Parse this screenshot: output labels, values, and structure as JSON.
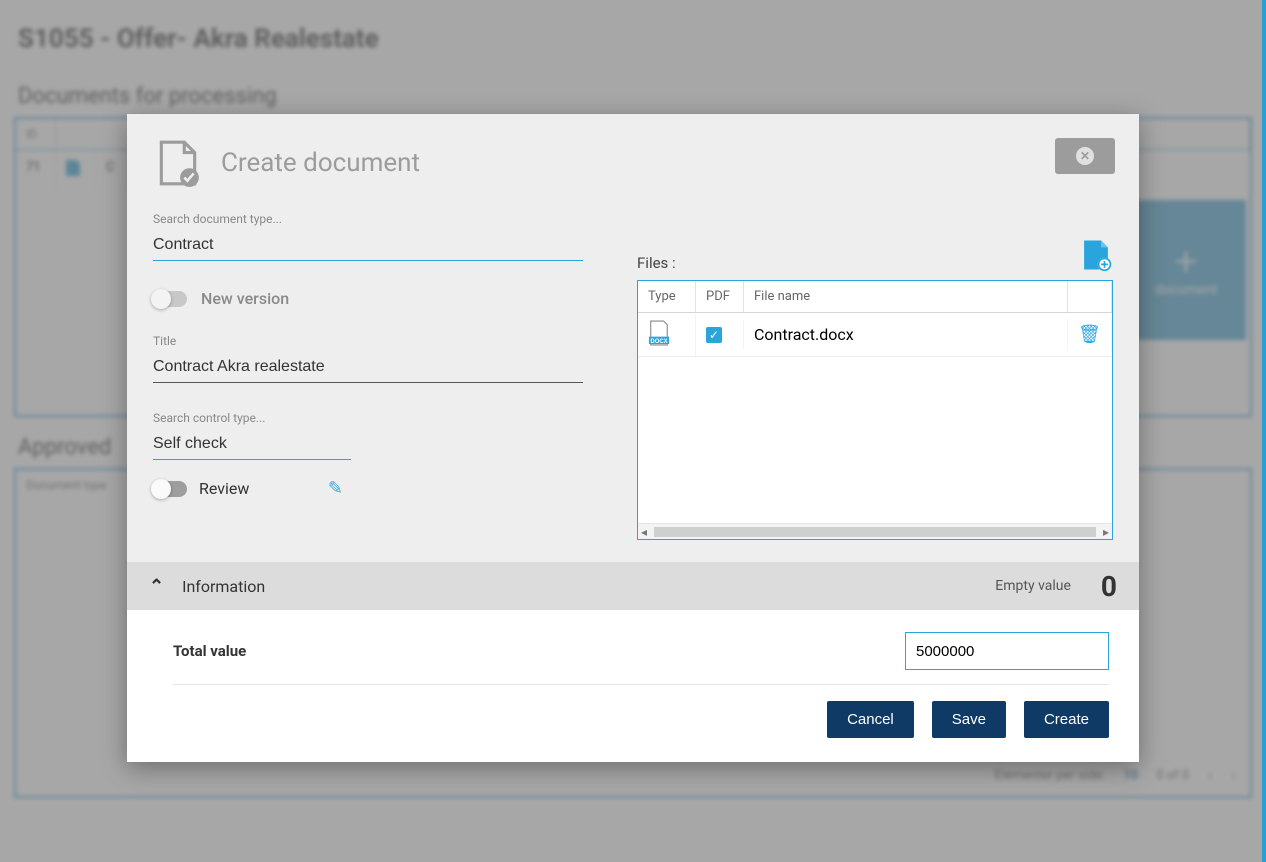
{
  "bg": {
    "page_title": "S1055 - Offer- Akra Realestate",
    "section_processing": "Documents for processing",
    "section_approved": "Approved",
    "id_header": "ID",
    "row_id": "71",
    "create_tile": "document",
    "lower_head": "Document type",
    "pager_label": "Elementer per side:",
    "pager_size": "10",
    "pager_range": "0 of 0"
  },
  "modal": {
    "title": "Create document",
    "doc_type_label": "Search document type...",
    "doc_type_value": "Contract",
    "new_version": "New version",
    "title_label": "Title",
    "title_value": "Contract Akra realestate",
    "control_label": "Search control type...",
    "control_value": "Self check",
    "review": "Review",
    "files_label": "Files :",
    "files_cols": {
      "type": "Type",
      "pdf": "PDF",
      "name": "File name"
    },
    "files_rows": [
      {
        "name": "Contract.docx",
        "pdf_checked": true
      }
    ],
    "info_header": "Information",
    "empty_label": "Empty value",
    "empty_count": "0",
    "total_value_label": "Total value",
    "total_value": "5000000",
    "buttons": {
      "cancel": "Cancel",
      "save": "Save",
      "create": "Create"
    }
  }
}
